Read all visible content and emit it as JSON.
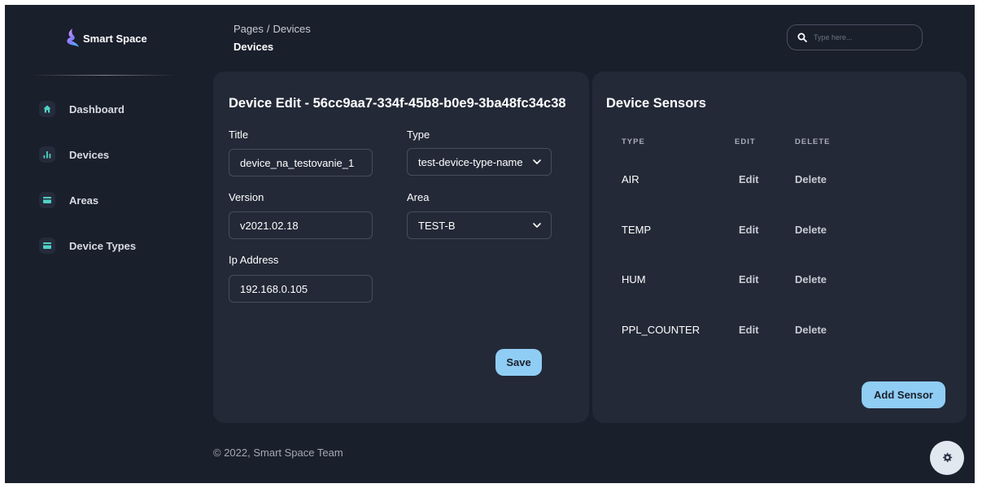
{
  "brand": {
    "name": "Smart Space"
  },
  "sidebar": {
    "items": [
      {
        "label": "Dashboard",
        "icon": "home-icon"
      },
      {
        "label": "Devices",
        "icon": "bar-chart-icon"
      },
      {
        "label": "Areas",
        "icon": "card-icon"
      },
      {
        "label": "Device Types",
        "icon": "card-icon"
      }
    ]
  },
  "header": {
    "breadcrumb_root": "Pages",
    "breadcrumb_sep": "/",
    "breadcrumb_current": "Devices",
    "page_title": "Devices",
    "search_placeholder": "Type here..."
  },
  "device_edit": {
    "title": "Device Edit - 56cc9aa7-334f-45b8-b0e9-3ba48fc34c38",
    "fields": {
      "title": {
        "label": "Title",
        "value": "device_na_testovanie_1"
      },
      "type": {
        "label": "Type",
        "value": "test-device-type-name"
      },
      "version": {
        "label": "Version",
        "value": "v2021.02.18"
      },
      "area": {
        "label": "Area",
        "value": "TEST-B"
      },
      "ip": {
        "label": "Ip Address",
        "value": "192.168.0.105"
      }
    },
    "save_label": "Save"
  },
  "sensors": {
    "title": "Device Sensors",
    "columns": [
      "TYPE",
      "EDIT",
      "DELETE"
    ],
    "rows": [
      {
        "type": "AIR",
        "edit": "Edit",
        "delete": "Delete"
      },
      {
        "type": "TEMP",
        "edit": "Edit",
        "delete": "Delete"
      },
      {
        "type": "HUM",
        "edit": "Edit",
        "delete": "Delete"
      },
      {
        "type": "PPL_COUNTER",
        "edit": "Edit",
        "delete": "Delete"
      }
    ],
    "add_label": "Add Sensor"
  },
  "footer": {
    "text": "© 2022, Smart Space Team"
  },
  "colors": {
    "accent_teal": "#4fd1c5",
    "button_blue": "#90cdf4",
    "background": "#1a1f2c",
    "card": "#232937"
  }
}
